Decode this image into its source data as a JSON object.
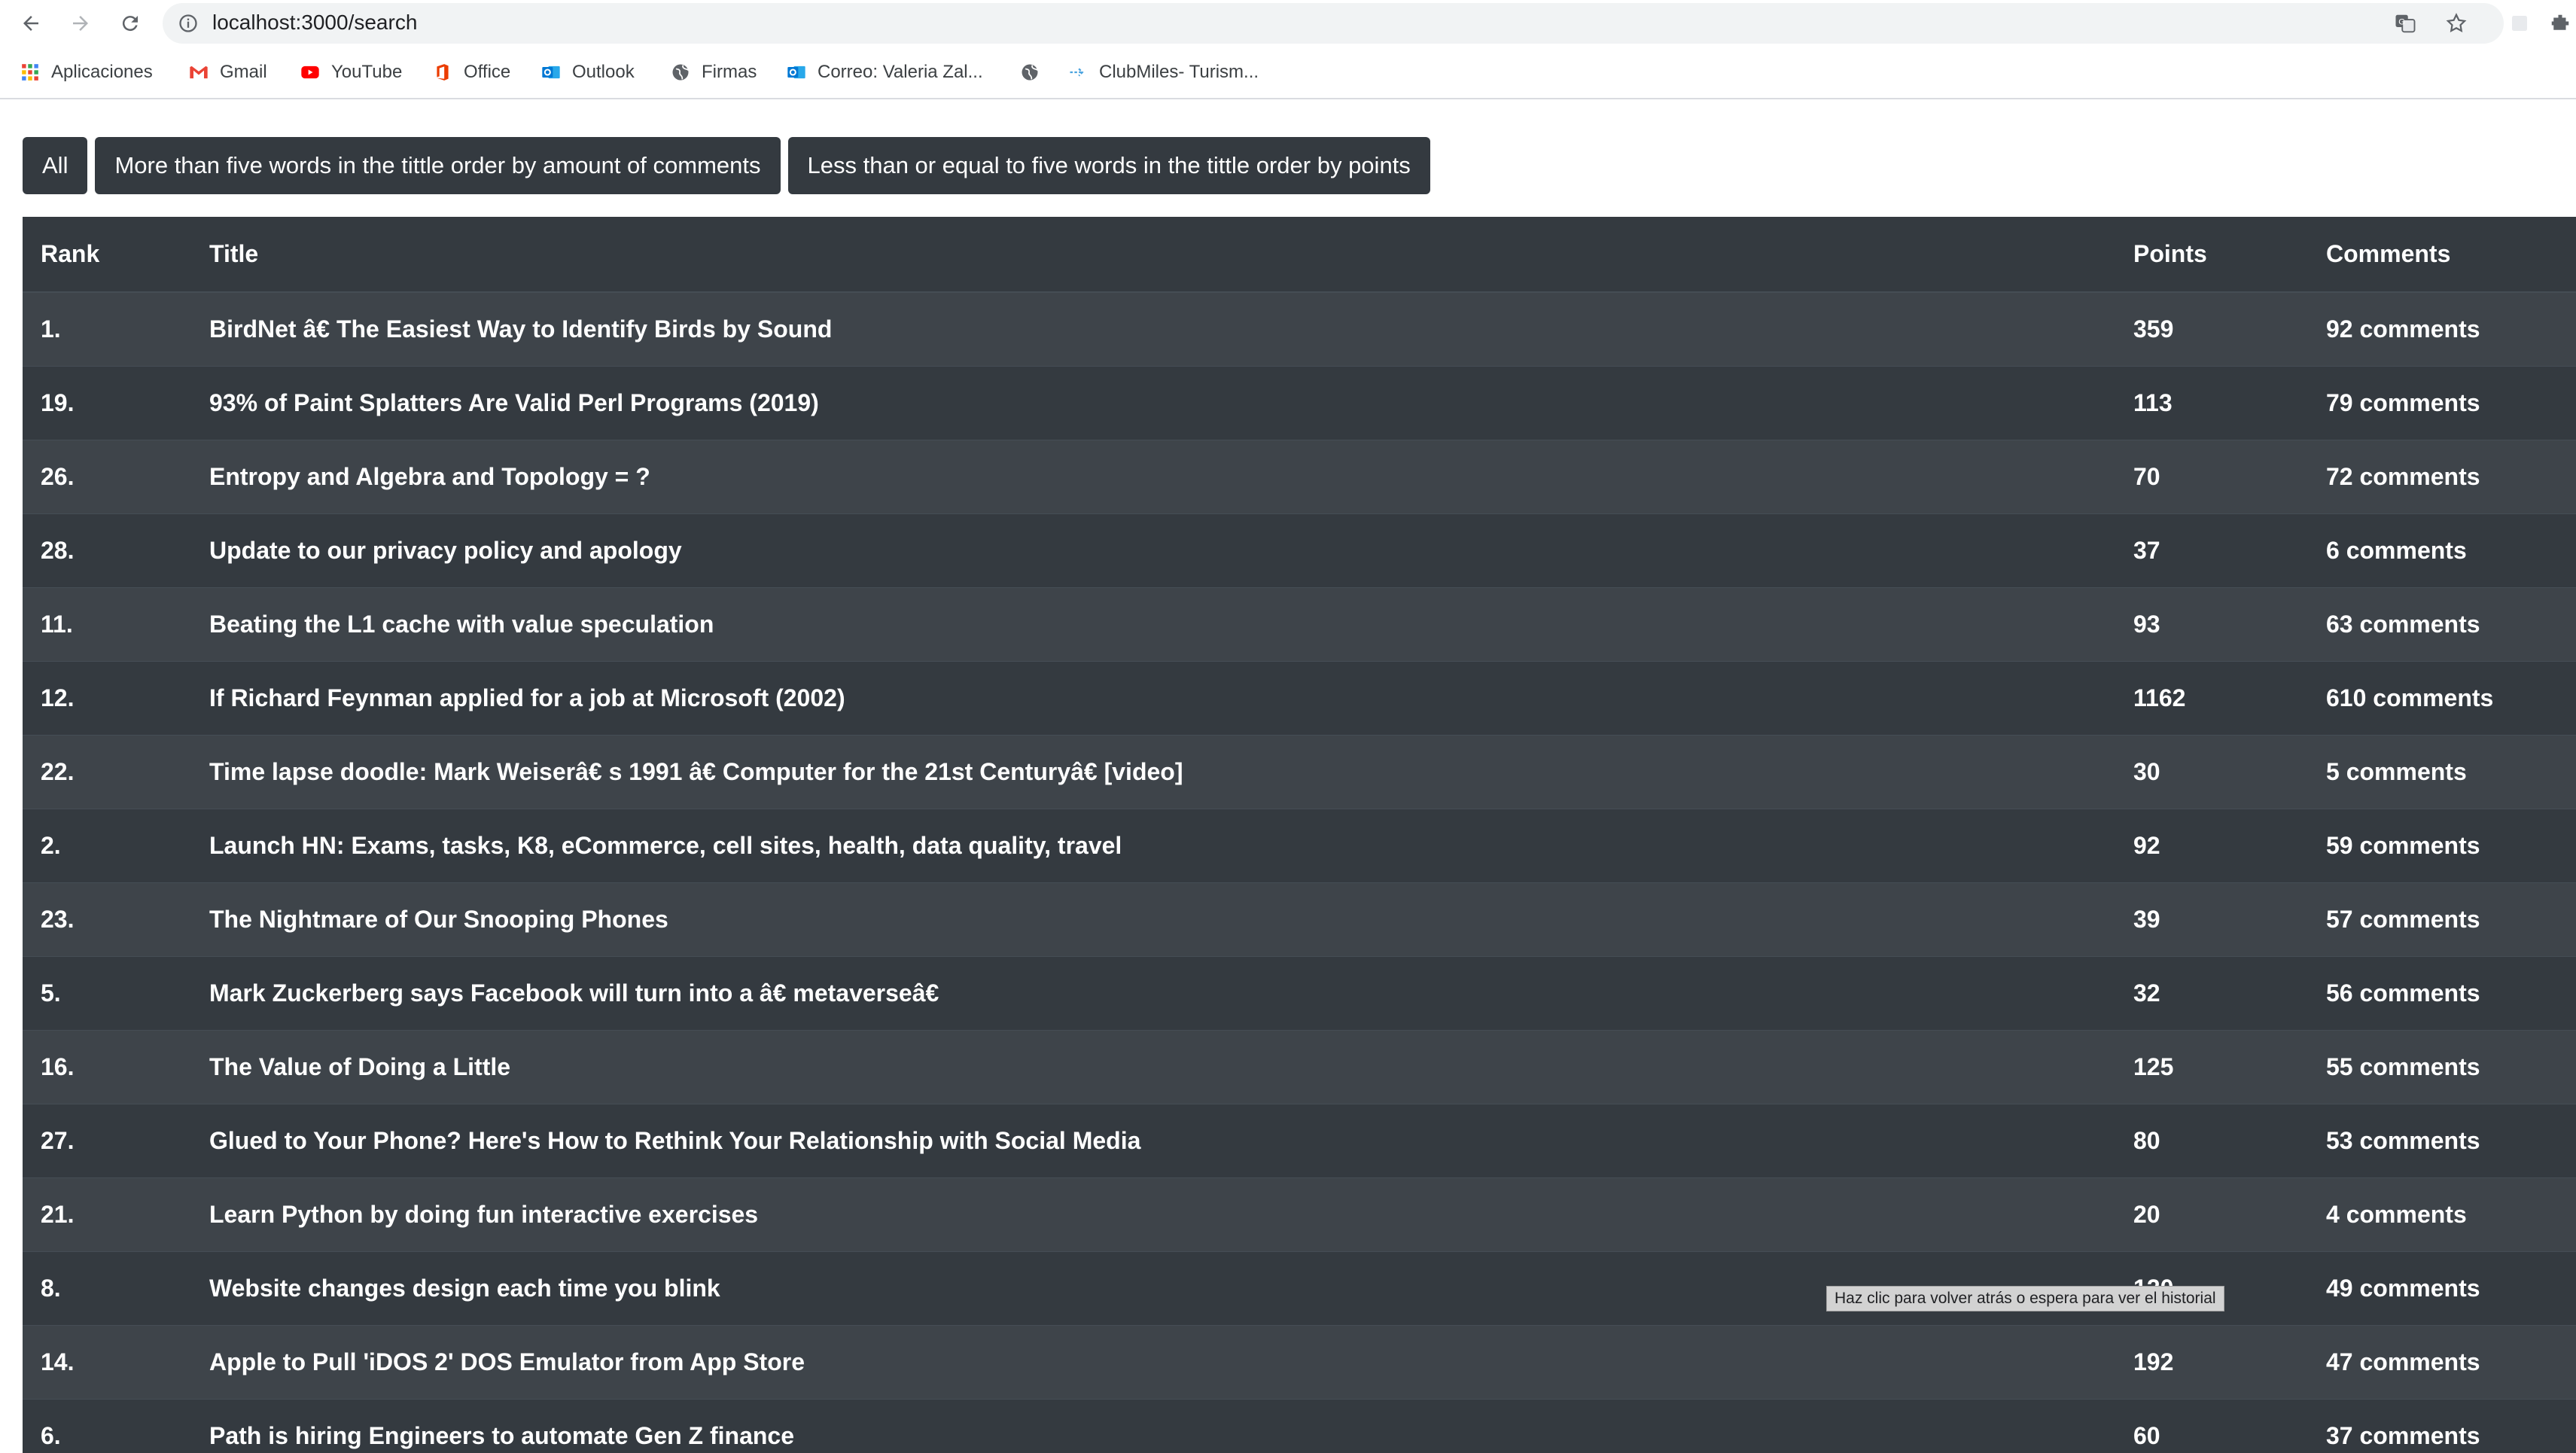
{
  "browser": {
    "url": "localhost:3000/search",
    "bookmarks": [
      {
        "label": "Aplicaciones",
        "icon": "apps-grid-icon"
      },
      {
        "label": "Gmail",
        "icon": "gmail-icon"
      },
      {
        "label": "YouTube",
        "icon": "youtube-icon"
      },
      {
        "label": "Office",
        "icon": "office-icon"
      },
      {
        "label": "Outlook",
        "icon": "outlook-icon"
      },
      {
        "label": "Firmas",
        "icon": "globe-icon"
      },
      {
        "label": "Correo: Valeria Zal...",
        "icon": "outlook-icon"
      },
      {
        "label": "",
        "icon": "globe-icon"
      },
      {
        "label": "ClubMiles- Turism...",
        "icon": "link-icon"
      }
    ],
    "tooltip": "Haz clic para volver atrás o espera para ver el historial"
  },
  "filters": {
    "all": "All",
    "more_than_five": "More than five words in the tittle order by amount of comments",
    "less_or_equal_five": "Less than or equal to five words in the tittle order by points"
  },
  "table": {
    "headers": {
      "rank": "Rank",
      "title": "Title",
      "points": "Points",
      "comments": "Comments"
    },
    "rows": [
      {
        "rank": "1.",
        "title": "BirdNet â€    The Easiest Way to Identify Birds by Sound",
        "points": "359",
        "comments": "92 comments"
      },
      {
        "rank": "19.",
        "title": "93% of Paint Splatters Are Valid Perl Programs (2019)",
        "points": "113",
        "comments": "79 comments"
      },
      {
        "rank": "26.",
        "title": "Entropy and Algebra and Topology = ?",
        "points": "70",
        "comments": "72 comments"
      },
      {
        "rank": "28.",
        "title": "Update to our privacy policy and apology",
        "points": "37",
        "comments": "6 comments"
      },
      {
        "rank": "11.",
        "title": "Beating the L1 cache with value speculation",
        "points": "93",
        "comments": "63 comments"
      },
      {
        "rank": "12.",
        "title": "If Richard Feynman applied for a job at Microsoft (2002)",
        "points": "1162",
        "comments": "610 comments"
      },
      {
        "rank": "22.",
        "title": "Time lapse doodle: Mark Weiserâ€    s 1991 â€    Computer for the 21st Centuryâ€     [video]",
        "points": "30",
        "comments": "5 comments"
      },
      {
        "rank": "2.",
        "title": "Launch HN: Exams, tasks, K8, eCommerce, cell sites, health, data quality, travel",
        "points": "92",
        "comments": "59 comments"
      },
      {
        "rank": "23.",
        "title": "The Nightmare of Our Snooping Phones",
        "points": "39",
        "comments": "57 comments"
      },
      {
        "rank": "5.",
        "title": "Mark Zuckerberg says Facebook will turn into a â€    metaverseâ€",
        "points": "32",
        "comments": "56 comments"
      },
      {
        "rank": "16.",
        "title": "The Value of Doing a Little",
        "points": "125",
        "comments": "55 comments"
      },
      {
        "rank": "27.",
        "title": "Glued to Your Phone? Here's How to Rethink Your Relationship with Social Media",
        "points": "80",
        "comments": "53 comments"
      },
      {
        "rank": "21.",
        "title": "Learn Python by doing fun interactive exercises",
        "points": "20",
        "comments": "4 comments"
      },
      {
        "rank": "8.",
        "title": "Website changes design each time you blink",
        "points": "120",
        "comments": "49 comments"
      },
      {
        "rank": "14.",
        "title": "Apple to Pull 'iDOS 2' DOS Emulator from App Store",
        "points": "192",
        "comments": "47 comments"
      },
      {
        "rank": "6.",
        "title": "Path is hiring Engineers to automate Gen Z finance",
        "points": "60",
        "comments": "37 comments"
      }
    ]
  },
  "colors": {
    "table_dark": "#343a40",
    "table_stripe": "#3e444a",
    "gmail_red": "#ea4335",
    "youtube_red": "#ff0000",
    "office_orange": "#eb3c00",
    "outlook_blue": "#0078d4"
  }
}
